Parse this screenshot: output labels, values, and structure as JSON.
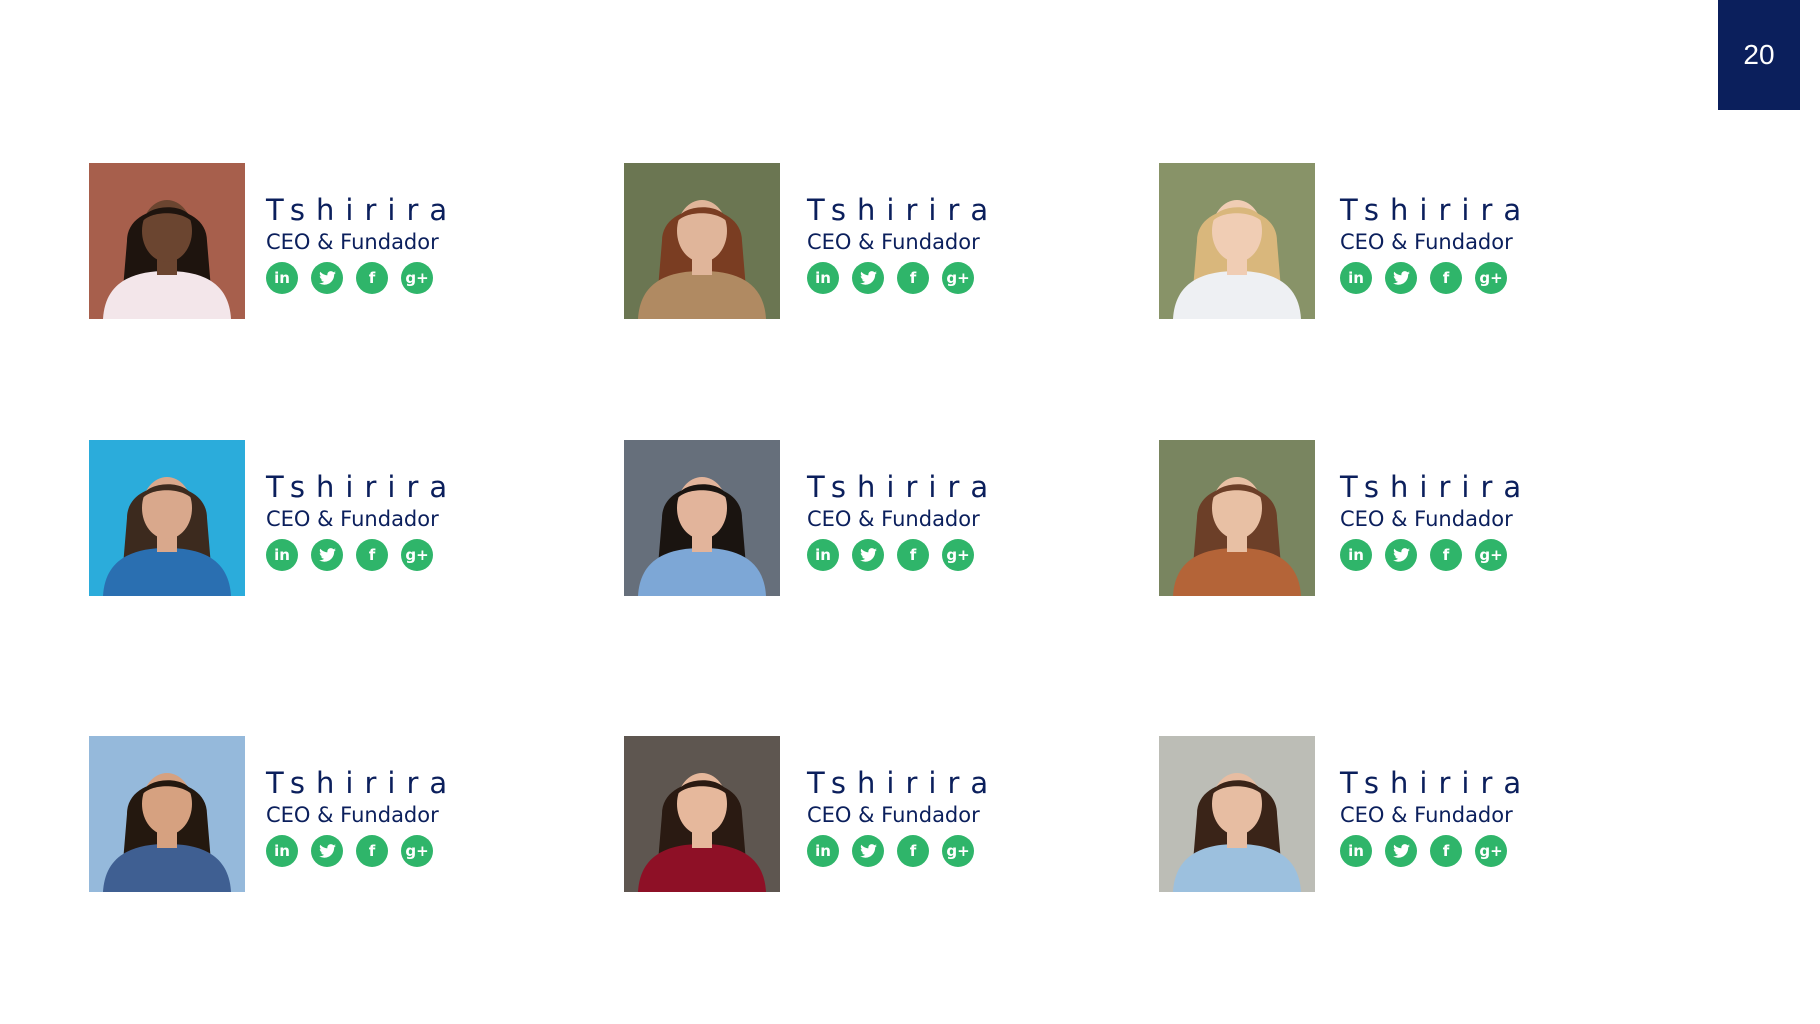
{
  "slide": {
    "page_number": "20"
  },
  "team": [
    {
      "name": "Tshirira",
      "role": "CEO & Fundador",
      "photo": {
        "bg": "#a0523d",
        "skin": "#6b4530",
        "hair": "#1e140e",
        "shirt": "#f3e6ea"
      }
    },
    {
      "name": "Tshirira",
      "role": "CEO & Fundador",
      "photo": {
        "bg": "#5f6b44",
        "skin": "#e0b59a",
        "hair": "#7a3d22",
        "shirt": "#b08a62"
      }
    },
    {
      "name": "Tshirira",
      "role": "CEO & Fundador",
      "photo": {
        "bg": "#7e8a5c",
        "skin": "#f0cdb4",
        "hair": "#d9b77c",
        "shirt": "#eef0f3"
      }
    },
    {
      "name": "Tshirira",
      "role": "CEO & Fundador",
      "photo": {
        "bg": "#1aa5d8",
        "skin": "#d9a88c",
        "hair": "#3c2a1e",
        "shirt": "#2a6fb1"
      }
    },
    {
      "name": "Tshirira",
      "role": "CEO & Fundador",
      "photo": {
        "bg": "#5a6370",
        "skin": "#e2b49b",
        "hair": "#1a1410",
        "shirt": "#7da7d6"
      }
    },
    {
      "name": "Tshirira",
      "role": "CEO & Fundador",
      "photo": {
        "bg": "#6e7b53",
        "skin": "#e8c0a4",
        "hair": "#6c3f28",
        "shirt": "#b46438"
      }
    },
    {
      "name": "Tshirira",
      "role": "CEO & Fundador",
      "photo": {
        "bg": "#8cb4d8",
        "skin": "#d6a180",
        "hair": "#24180f",
        "shirt": "#3f5f92"
      }
    },
    {
      "name": "Tshirira",
      "role": "CEO & Fundador",
      "photo": {
        "bg": "#514842",
        "skin": "#e6b89c",
        "hair": "#2a1a12",
        "shirt": "#8e1026"
      }
    },
    {
      "name": "Tshirira",
      "role": "CEO & Fundador",
      "photo": {
        "bg": "#b7b8b0",
        "skin": "#e7bda2",
        "hair": "#3a2418",
        "shirt": "#9cc0de"
      }
    }
  ],
  "social_icons": [
    {
      "name": "linkedin-icon",
      "glyph": "in"
    },
    {
      "name": "twitter-icon",
      "glyph": ""
    },
    {
      "name": "facebook-icon",
      "glyph": "f"
    },
    {
      "name": "google-plus-icon",
      "glyph": "g+"
    }
  ],
  "colors": {
    "accent": "#2fb56a",
    "primary": "#0b1f5c",
    "background": "#ffffff"
  }
}
